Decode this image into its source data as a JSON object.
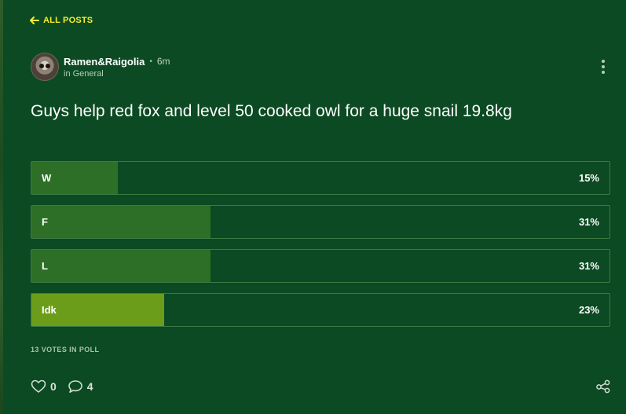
{
  "nav": {
    "back_label": "ALL POSTS",
    "back_icon": "arrow-left-icon"
  },
  "post": {
    "author": "Ramen&Raigolia",
    "separator": "•",
    "time_ago": "6m",
    "category": "in General",
    "title": "Guys help red fox and level 50 cooked owl for a huge snail 19.8kg",
    "menu_icon": "more-vertical-icon"
  },
  "poll": {
    "options": [
      {
        "label": "W",
        "percent": "15%",
        "value": 15,
        "selected": false
      },
      {
        "label": "F",
        "percent": "31%",
        "value": 31,
        "selected": false
      },
      {
        "label": "L",
        "percent": "31%",
        "value": 31,
        "selected": false
      },
      {
        "label": "Idk",
        "percent": "23%",
        "value": 23,
        "selected": true
      }
    ],
    "vote_summary": "13 VOTES IN POLL"
  },
  "actions": {
    "likes": "0",
    "comments": "4",
    "like_icon": "heart-icon",
    "comment_icon": "comment-icon",
    "share_icon": "share-icon"
  },
  "colors": {
    "background": "#0b4a22",
    "accent": "#f5ee2a",
    "bar_fill": "#2e6f27",
    "bar_fill_selected": "#6b9d1b",
    "bar_border": "#3c7a45"
  }
}
